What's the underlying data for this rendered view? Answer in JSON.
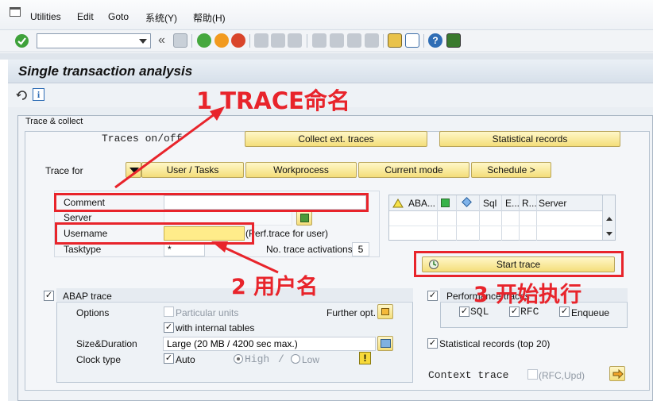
{
  "menubar": {
    "items": [
      "Utilities",
      "Edit",
      "Goto",
      "系统(Y)",
      "帮助(H)"
    ]
  },
  "toolbar": {
    "command_field_value": "",
    "icons": [
      "enter-icon",
      "save-icon",
      "back-icon",
      "exit-icon",
      "cancel-icon",
      "print-icon",
      "find-icon",
      "find-next-icon",
      "first-page-icon",
      "previous-page-icon",
      "next-page-icon",
      "last-page-icon",
      "new-session-icon",
      "shortcut-icon",
      "help-icon",
      "customize-layout-icon"
    ]
  },
  "screen": {
    "title": "Single transaction analysis"
  },
  "trace_collect": {
    "group_title": "Trace & collect",
    "traces_onoff": "Traces on/off",
    "collect_ext_traces": "Collect ext. traces",
    "statistical_records_btn": "Statistical records",
    "trace_for": "Trace for",
    "tabs": [
      "User / Tasks",
      "Workprocess",
      "Current mode",
      "Schedule >"
    ],
    "fields": {
      "comment_label": "Comment",
      "comment_value": "",
      "server_label": "Server",
      "server_value": "",
      "username_label": "Username",
      "username_value": "",
      "username_hint": "(Perf.trace for user)",
      "tasktype_label": "Tasktype",
      "tasktype_value": "*",
      "no_trace_label": "No. trace activations",
      "no_trace_value": "5"
    },
    "grid": {
      "columns": [
        "ABA...",
        "Sql",
        "E...",
        "R...",
        "Server"
      ]
    },
    "start_trace": "Start trace",
    "abap_trace": {
      "title": "ABAP trace",
      "checked": true,
      "options_label": "Options",
      "particular_units": "Particular units",
      "particular_units_checked": false,
      "further_opt": "Further opt.",
      "internal_tables": "with internal tables",
      "internal_tables_checked": true,
      "size_duration_label": "Size&Duration",
      "size_duration_value": "Large (20 MB / 4200 sec max.)",
      "clock_type_label": "Clock type",
      "auto": "Auto",
      "auto_checked": true,
      "high": "High",
      "low": "Low",
      "slash": "/"
    },
    "performance_traces": {
      "title": "Performance traces",
      "checked": true,
      "sql": "SQL",
      "rfc": "RFC",
      "enqueue": "Enqueue"
    },
    "statistical_records_check": "Statistical records (top 20)",
    "context_trace": "Context trace",
    "rfc_upd": "(RFC,Upd)"
  },
  "annotations": {
    "a1": "1 TRACE命名",
    "a2": "2 用户名",
    "a3": "3 开始执行",
    "color": "#e8242b"
  }
}
